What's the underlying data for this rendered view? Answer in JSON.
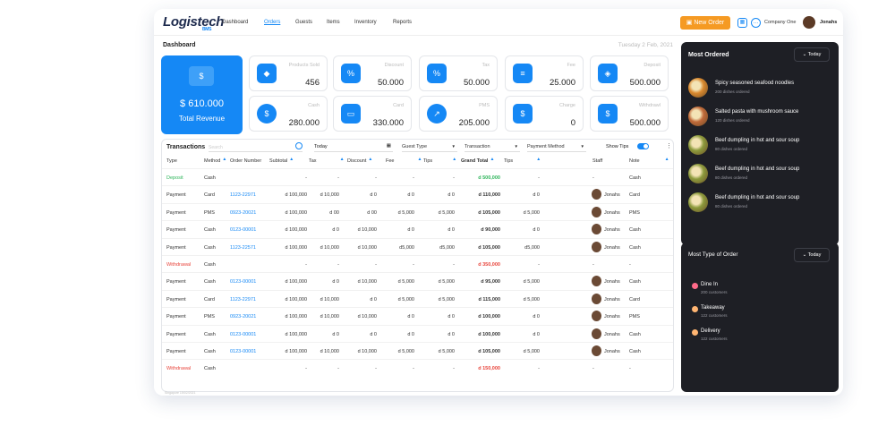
{
  "header": {
    "logo": "Logistech",
    "logo_sub": "BMS",
    "nav": [
      "Dashboard",
      "Orders",
      "Guests",
      "Items",
      "Inventory",
      "Reports"
    ],
    "new_order": "New Order",
    "company": "Company One",
    "user": "Jonahs"
  },
  "dashboard": {
    "title": "Dashboard",
    "date": "Tuesday 2 Feb, 2021"
  },
  "revenue": {
    "value": "$ 610.000",
    "label": "Total Revenue"
  },
  "stats": [
    {
      "label": "Products Sold",
      "value": "456"
    },
    {
      "label": "Discount",
      "value": "50.000"
    },
    {
      "label": "Tax",
      "value": "50.000"
    },
    {
      "label": "Fee",
      "value": "25.000"
    },
    {
      "label": "Deposit",
      "value": "500.000"
    },
    {
      "label": "Cash",
      "value": "280.000"
    },
    {
      "label": "Card",
      "value": "330.000"
    },
    {
      "label": "PMS",
      "value": "205.000"
    },
    {
      "label": "Charge",
      "value": "0"
    },
    {
      "label": "Withdrawl",
      "value": "500.000"
    }
  ],
  "transactions": {
    "title": "Transactions",
    "search_placeholder": "Search",
    "date_filter": "Today",
    "filters": [
      "Guest Type",
      "Transaction",
      "Payment Method"
    ],
    "show_tips": "Show Tips",
    "columns": [
      "Type",
      "Method",
      "Order Number",
      "Subtotal",
      "Tax",
      "Discount",
      "Fee",
      "Tips",
      "Grand Total",
      "Tips",
      "Staff",
      "Note"
    ],
    "rows": [
      {
        "type": "Deposit",
        "method": "Cash",
        "order": "",
        "subtotal": "-",
        "tax": "-",
        "discount": "-",
        "fee": "-",
        "tips": "-",
        "grand": "d 500,000",
        "tips2": "-",
        "staff": "-",
        "note": "Cash"
      },
      {
        "type": "Payment",
        "method": "Card",
        "order": "1123-22971",
        "subtotal": "d 100,000",
        "tax": "d 10,000",
        "discount": "d 0",
        "fee": "d 0",
        "tips": "d 0",
        "grand": "d 110,000",
        "tips2": "d 0",
        "staff": "Jonahs",
        "note": "Card"
      },
      {
        "type": "Payment",
        "method": "PMS",
        "order": "0923-20021",
        "subtotal": "d 100,000",
        "tax": "d 00",
        "discount": "d 00",
        "fee": "d 5,000",
        "tips": "d 5,000",
        "grand": "d 105,000",
        "tips2": "d 5,000",
        "staff": "Jonahs",
        "note": "PMS"
      },
      {
        "type": "Payment",
        "method": "Cash",
        "order": "0123-00001",
        "subtotal": "d 100,000",
        "tax": "d 0",
        "discount": "d 10,000",
        "fee": "d 0",
        "tips": "d 0",
        "grand": "d 90,000",
        "tips2": "d 0",
        "staff": "Jonahs",
        "note": "Cash"
      },
      {
        "type": "Payment",
        "method": "Cash",
        "order": "1123-22571",
        "subtotal": "d 100,000",
        "tax": "d 10,000",
        "discount": "d 10,000",
        "fee": "d5,000",
        "tips": "d5,000",
        "grand": "d 105,000",
        "tips2": "d5,000",
        "staff": "Jonahs",
        "note": "Cash"
      },
      {
        "type": "Withdrawal",
        "method": "Cash",
        "order": "",
        "subtotal": "-",
        "tax": "-",
        "discount": "-",
        "fee": "-",
        "tips": "-",
        "grand": "d 350,000",
        "tips2": "-",
        "staff": "-",
        "note": "-"
      },
      {
        "type": "Payment",
        "method": "Cash",
        "order": "0123-00001",
        "subtotal": "d 100,000",
        "tax": "d 0",
        "discount": "d 10,000",
        "fee": "d 5,000",
        "tips": "d 5,000",
        "grand": "d 95,000",
        "tips2": "d 5,000",
        "staff": "Jonahs",
        "note": "Cash"
      },
      {
        "type": "Payment",
        "method": "Card",
        "order": "1123-22971",
        "subtotal": "d 100,000",
        "tax": "d 10,000",
        "discount": "d 0",
        "fee": "d 5,000",
        "tips": "d 5,000",
        "grand": "d 115,000",
        "tips2": "d 5,000",
        "staff": "Jonahs",
        "note": "Card"
      },
      {
        "type": "Payment",
        "method": "PMS",
        "order": "0923-20021",
        "subtotal": "d 100,000",
        "tax": "d 10,000",
        "discount": "d 10,000",
        "fee": "d 0",
        "tips": "d 0",
        "grand": "d 100,000",
        "tips2": "d 0",
        "staff": "Jonahs",
        "note": "PMS"
      },
      {
        "type": "Payment",
        "method": "Cash",
        "order": "0123-00001",
        "subtotal": "d 100,000",
        "tax": "d 0",
        "discount": "d 0",
        "fee": "d 0",
        "tips": "d 0",
        "grand": "d 100,000",
        "tips2": "d 0",
        "staff": "Jonahs",
        "note": "Cash"
      },
      {
        "type": "Payment",
        "method": "Cash",
        "order": "0123-00001",
        "subtotal": "d 100,000",
        "tax": "d 10,000",
        "discount": "d 10,000",
        "fee": "d 5,000",
        "tips": "d 5,000",
        "grand": "d 105,000",
        "tips2": "d 5,000",
        "staff": "Jonahs",
        "note": "Cash"
      },
      {
        "type": "Withdrawal",
        "method": "Cash",
        "order": "",
        "subtotal": "-",
        "tax": "-",
        "discount": "-",
        "fee": "-",
        "tips": "-",
        "grand": "d 150,000",
        "tips2": "-",
        "staff": "-",
        "note": "-"
      }
    ],
    "footnote": "Singapore 15/02/2021"
  },
  "most_ordered": {
    "title": "Most Ordered",
    "period": "Today",
    "items": [
      {
        "name": "Spicy seasoned seafood noodles",
        "sub": "200 dishes ordered",
        "color": "#d9892f"
      },
      {
        "name": "Salted pasta with mushroom sauce",
        "sub": "120 dishes ordered",
        "color": "#c06a3a"
      },
      {
        "name": "Beef dumpling in hot and sour soup",
        "sub": "80 dishes ordered",
        "color": "#8c9a3c"
      },
      {
        "name": "Beef dumpling in hot and sour soup",
        "sub": "80 dishes ordered",
        "color": "#8c9a3c"
      },
      {
        "name": "Beef dumpling in hot and sour soup",
        "sub": "80 dishes ordered",
        "color": "#8c9a3c"
      }
    ]
  },
  "order_types": {
    "title": "Most Type of Order",
    "period": "Today",
    "items": [
      {
        "name": "Dine In",
        "sub": "200 customers",
        "color": "#ff6b8a"
      },
      {
        "name": "Takeaway",
        "sub": "122 customers",
        "color": "#ffb572"
      },
      {
        "name": "Delivery",
        "sub": "122 customers",
        "color": "#ffb572"
      }
    ]
  }
}
